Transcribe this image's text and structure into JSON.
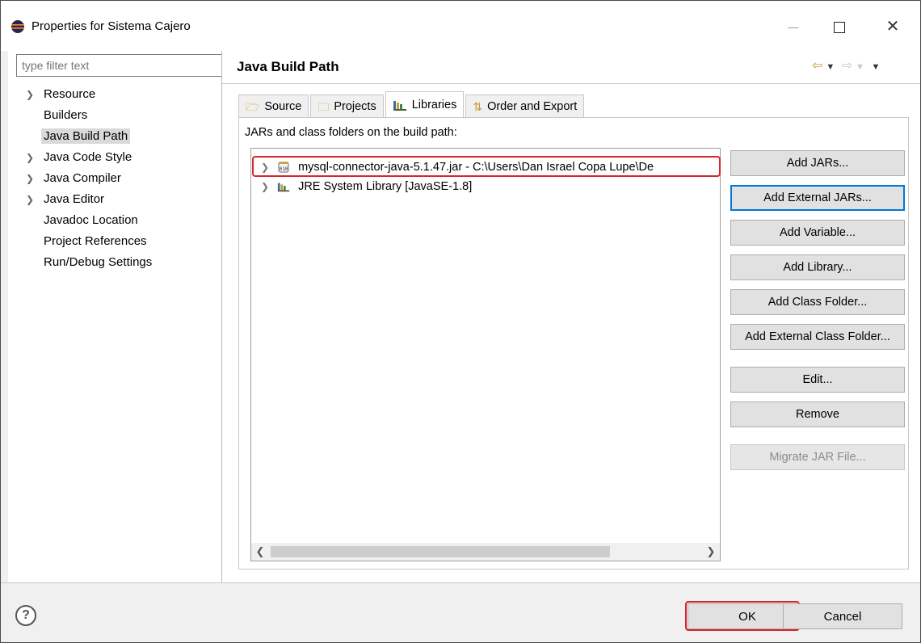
{
  "window": {
    "title": "Properties for Sistema Cajero",
    "controls": {
      "minimize": "",
      "maximize": "",
      "close": "✕"
    }
  },
  "sidebar": {
    "filter_placeholder": "type filter text",
    "items": [
      {
        "label": "Resource",
        "expandable": true
      },
      {
        "label": "Builders",
        "expandable": false
      },
      {
        "label": "Java Build Path",
        "expandable": false,
        "selected": true
      },
      {
        "label": "Java Code Style",
        "expandable": true
      },
      {
        "label": "Java Compiler",
        "expandable": true
      },
      {
        "label": "Java Editor",
        "expandable": true
      },
      {
        "label": "Javadoc Location",
        "expandable": false
      },
      {
        "label": "Project References",
        "expandable": false
      },
      {
        "label": "Run/Debug Settings",
        "expandable": false
      }
    ]
  },
  "main": {
    "title": "Java Build Path",
    "tabs": [
      {
        "label": "Source",
        "icon": "source-folder-icon"
      },
      {
        "label": "Projects",
        "icon": "projects-icon"
      },
      {
        "label": "Libraries",
        "icon": "libraries-icon",
        "active": true
      },
      {
        "label": "Order and Export",
        "icon": "order-export-icon"
      }
    ],
    "content_label": "JARs and class folders on the build path:",
    "entries": [
      {
        "label": "mysql-connector-java-5.1.47.jar - C:\\Users\\Dan Israel Copa Lupe\\De",
        "icon": "jar-icon"
      },
      {
        "label": "JRE System Library [JavaSE-1.8]",
        "icon": "library-icon"
      }
    ],
    "buttons": {
      "add_jars": "Add JARs...",
      "add_external_jars": "Add External JARs...",
      "add_variable": "Add Variable...",
      "add_library": "Add Library...",
      "add_class_folder": "Add Class Folder...",
      "add_external_class_folder": "Add External Class Folder...",
      "edit": "Edit...",
      "remove": "Remove",
      "migrate_jar": "Migrate JAR File..."
    }
  },
  "footer": {
    "help": "?",
    "ok": "OK",
    "cancel": "Cancel"
  },
  "colors": {
    "highlight": "#d8252f",
    "focus": "#0078d7",
    "selected_bg": "#d9d9d9"
  }
}
